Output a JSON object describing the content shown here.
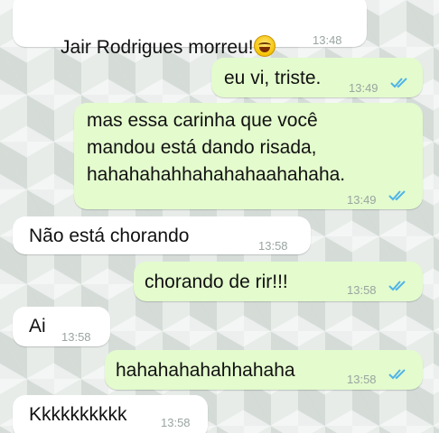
{
  "messages": [
    {
      "direction": "incoming",
      "text": "Jair Rodrigues morreu!",
      "emoji": "laughing-crying-emoji",
      "time": "13:48"
    },
    {
      "direction": "outgoing",
      "text": "eu vi, triste.",
      "time": "13:49",
      "status": "read"
    },
    {
      "direction": "outgoing",
      "text_lines": [
        "mas essa carinha que você",
        "mandou está dando risada,",
        "hahahahahhahahahaahahaha."
      ],
      "time": "13:49",
      "status": "read"
    },
    {
      "direction": "incoming",
      "text": "Não está chorando",
      "time": "13:58"
    },
    {
      "direction": "outgoing",
      "text": "chorando de rir!!!",
      "time": "13:58",
      "status": "read"
    },
    {
      "direction": "incoming",
      "text": "Ai",
      "time": "13:58"
    },
    {
      "direction": "outgoing",
      "text": "hahahahahahhahaha",
      "time": "13:58",
      "status": "read"
    },
    {
      "direction": "incoming",
      "text": "Kkkkkkkkkk",
      "time": "13:58"
    }
  ],
  "colors": {
    "incoming_bubble": "#ffffff",
    "outgoing_bubble": "#e3fbcd",
    "read_ticks": "#4fb3e8",
    "timestamp": "#9aa5a0"
  }
}
